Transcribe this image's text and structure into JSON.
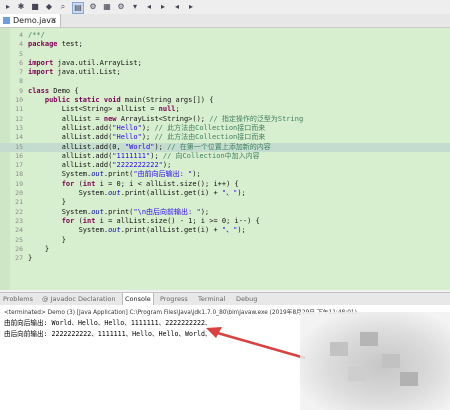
{
  "editor_tab": {
    "label": "Demo.java"
  },
  "code_lines": [
    {
      "n": "4",
      "segs": [
        {
          "t": "/**/",
          "c": "cmt"
        }
      ]
    },
    {
      "n": "4",
      "segs": [
        {
          "t": "package",
          "c": "kw"
        },
        {
          "t": " test;",
          "c": ""
        }
      ]
    },
    {
      "n": "5",
      "segs": []
    },
    {
      "n": "6",
      "segs": [
        {
          "t": "import",
          "c": "kw"
        },
        {
          "t": " java.util.ArrayList;",
          "c": ""
        }
      ]
    },
    {
      "n": "7",
      "segs": [
        {
          "t": "import",
          "c": "kw"
        },
        {
          "t": " java.util.List;",
          "c": ""
        }
      ]
    },
    {
      "n": "8",
      "segs": []
    },
    {
      "n": "9",
      "segs": [
        {
          "t": "class",
          "c": "kw"
        },
        {
          "t": " Demo {",
          "c": ""
        }
      ]
    },
    {
      "n": "10",
      "segs": [
        {
          "t": "    public static void",
          "c": "kw"
        },
        {
          "t": " main(String args[]) {",
          "c": ""
        }
      ]
    },
    {
      "n": "11",
      "segs": [
        {
          "t": "        List<String> allList = ",
          "c": ""
        },
        {
          "t": "null",
          "c": "kw"
        },
        {
          "t": ";",
          "c": ""
        }
      ]
    },
    {
      "n": "12",
      "segs": [
        {
          "t": "        allList = ",
          "c": ""
        },
        {
          "t": "new",
          "c": "kw"
        },
        {
          "t": " ArrayList<String>(); ",
          "c": ""
        },
        {
          "t": "// 指定操作的泛型为String",
          "c": "cmt"
        }
      ]
    },
    {
      "n": "13",
      "segs": [
        {
          "t": "        allList.add(",
          "c": ""
        },
        {
          "t": "\"Hello\"",
          "c": "str"
        },
        {
          "t": "); ",
          "c": ""
        },
        {
          "t": "// 此方法由Collection接口而来",
          "c": "cmt"
        }
      ]
    },
    {
      "n": "14",
      "segs": [
        {
          "t": "        allList.add(",
          "c": ""
        },
        {
          "t": "\"Hello\"",
          "c": "str"
        },
        {
          "t": "); ",
          "c": ""
        },
        {
          "t": "// 此方法由Collection接口而来",
          "c": "cmt"
        }
      ]
    },
    {
      "n": "15",
      "segs": [
        {
          "t": "        allList.add(0, ",
          "c": ""
        },
        {
          "t": "\"World\"",
          "c": "str"
        },
        {
          "t": "); ",
          "c": ""
        },
        {
          "t": "// 在第一个位置上添加新的内容",
          "c": "cmt"
        }
      ]
    },
    {
      "n": "16",
      "segs": [
        {
          "t": "        allList.add(",
          "c": ""
        },
        {
          "t": "\"1111111\"",
          "c": "str"
        },
        {
          "t": "); ",
          "c": ""
        },
        {
          "t": "// 向Collection中加入内容",
          "c": "cmt"
        }
      ]
    },
    {
      "n": "17",
      "segs": [
        {
          "t": "        allList.add(",
          "c": ""
        },
        {
          "t": "\"2222222222\"",
          "c": "str"
        },
        {
          "t": ");",
          "c": ""
        }
      ]
    },
    {
      "n": "18",
      "segs": [
        {
          "t": "        System.",
          "c": ""
        },
        {
          "t": "out",
          "c": "fld"
        },
        {
          "t": ".print(",
          "c": ""
        },
        {
          "t": "\"由前向后输出: \"",
          "c": "str"
        },
        {
          "t": ");",
          "c": ""
        }
      ]
    },
    {
      "n": "19",
      "segs": [
        {
          "t": "        for",
          "c": "kw"
        },
        {
          "t": " (",
          "c": ""
        },
        {
          "t": "int",
          "c": "kw"
        },
        {
          "t": " i = 0; i < allList.size(); i++) {",
          "c": ""
        }
      ]
    },
    {
      "n": "20",
      "segs": [
        {
          "t": "            System.",
          "c": ""
        },
        {
          "t": "out",
          "c": "fld"
        },
        {
          "t": ".print(allList.get(i) + ",
          "c": ""
        },
        {
          "t": "\"、\"",
          "c": "str"
        },
        {
          "t": ");",
          "c": ""
        }
      ]
    },
    {
      "n": "21",
      "segs": [
        {
          "t": "        }",
          "c": ""
        }
      ]
    },
    {
      "n": "22",
      "segs": [
        {
          "t": "        System.",
          "c": ""
        },
        {
          "t": "out",
          "c": "fld"
        },
        {
          "t": ".print(",
          "c": ""
        },
        {
          "t": "\"\\n由后向前输出: \"",
          "c": "str"
        },
        {
          "t": ");",
          "c": ""
        }
      ]
    },
    {
      "n": "23",
      "segs": [
        {
          "t": "        for",
          "c": "kw"
        },
        {
          "t": " (",
          "c": ""
        },
        {
          "t": "int",
          "c": "kw"
        },
        {
          "t": " i = allList.size() - 1; i >= 0; i--) {",
          "c": ""
        }
      ]
    },
    {
      "n": "24",
      "segs": [
        {
          "t": "            System.",
          "c": ""
        },
        {
          "t": "out",
          "c": "fld"
        },
        {
          "t": ".print(allList.get(i) + ",
          "c": ""
        },
        {
          "t": "\"、\"",
          "c": "str"
        },
        {
          "t": ");",
          "c": ""
        }
      ]
    },
    {
      "n": "25",
      "segs": [
        {
          "t": "        }",
          "c": ""
        }
      ]
    },
    {
      "n": "26",
      "segs": [
        {
          "t": "    }",
          "c": ""
        }
      ]
    },
    {
      "n": "27",
      "segs": [
        {
          "t": "}",
          "c": ""
        }
      ]
    }
  ],
  "panel_tabs": [
    "Problems",
    "@ Javadoc",
    "Declaration",
    "Console",
    "Progress",
    "Terminal",
    "Debug"
  ],
  "console": {
    "status": "<terminated> Demo (3) [Java Application] C:\\Program Files\\Java\\jdk1.7.0_80\\bin\\javaw.exe (2019年8月29日 下午11:48:01)",
    "output_line1": "由前向后输出: World、Hello、Hello、1111111、2222222222、",
    "output_line2": "由后向前输出: 2222222222、1111111、Hello、Hello、World、"
  },
  "colors": {
    "editor_bg": "#d8efcf",
    "arrow": "#d94040"
  }
}
